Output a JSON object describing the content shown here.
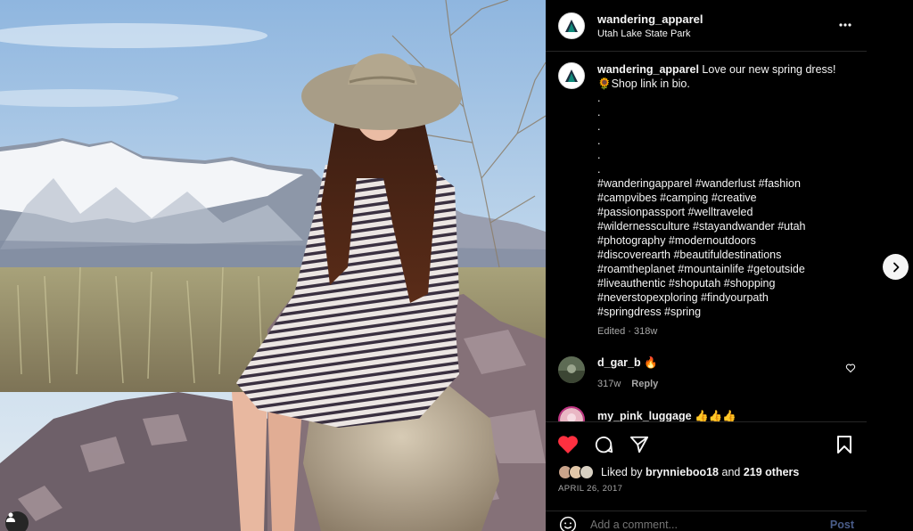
{
  "post": {
    "username": "wandering_apparel",
    "location": "Utah Lake State Park"
  },
  "caption": {
    "username": "wandering_apparel",
    "text_line1": "Love our new spring dress!",
    "text_line2": "🌻Shop link in bio.",
    "dots": [
      ".",
      ".",
      ".",
      ".",
      ".",
      "."
    ],
    "hashtag_lines": [
      "#wanderingapparel #wanderlust #fashion",
      "#campvibes #camping #creative",
      "#passionpassport #welltraveled",
      "#wildernessculture #stayandwander #utah",
      "#photography #modernoutdoors",
      "#discoverearth #beautifuldestinations",
      "#roamtheplanet #mountainlife #getoutside",
      "#liveauthentic #shoputah #shopping",
      "#neverstopexploring #findyourpath",
      "#springdress #spring"
    ],
    "meta": "Edited · 318w"
  },
  "comments": [
    {
      "username": "d_gar_b",
      "text": "🔥",
      "age": "317w",
      "reply_label": "Reply"
    },
    {
      "username": "my_pink_luggage",
      "text": "👍👍👍"
    }
  ],
  "likes": {
    "prefix": "Liked by",
    "user": "brynnieboo18",
    "conjunction": "and",
    "others": "219 others"
  },
  "date": "APRIL 26, 2017",
  "add_comment": {
    "placeholder": "Add a comment...",
    "post_label": "Post"
  },
  "colors": {
    "like_red": "#ff3040",
    "background": "#000000",
    "text": "#f5f5f5",
    "muted": "#a8a8a8",
    "post_button": "#4a5d8a"
  },
  "icons": [
    "more-icon",
    "heart-icon",
    "comment-icon",
    "share-icon",
    "bookmark-icon",
    "emoji-icon",
    "chevron-right-icon",
    "user-tag-icon"
  ]
}
